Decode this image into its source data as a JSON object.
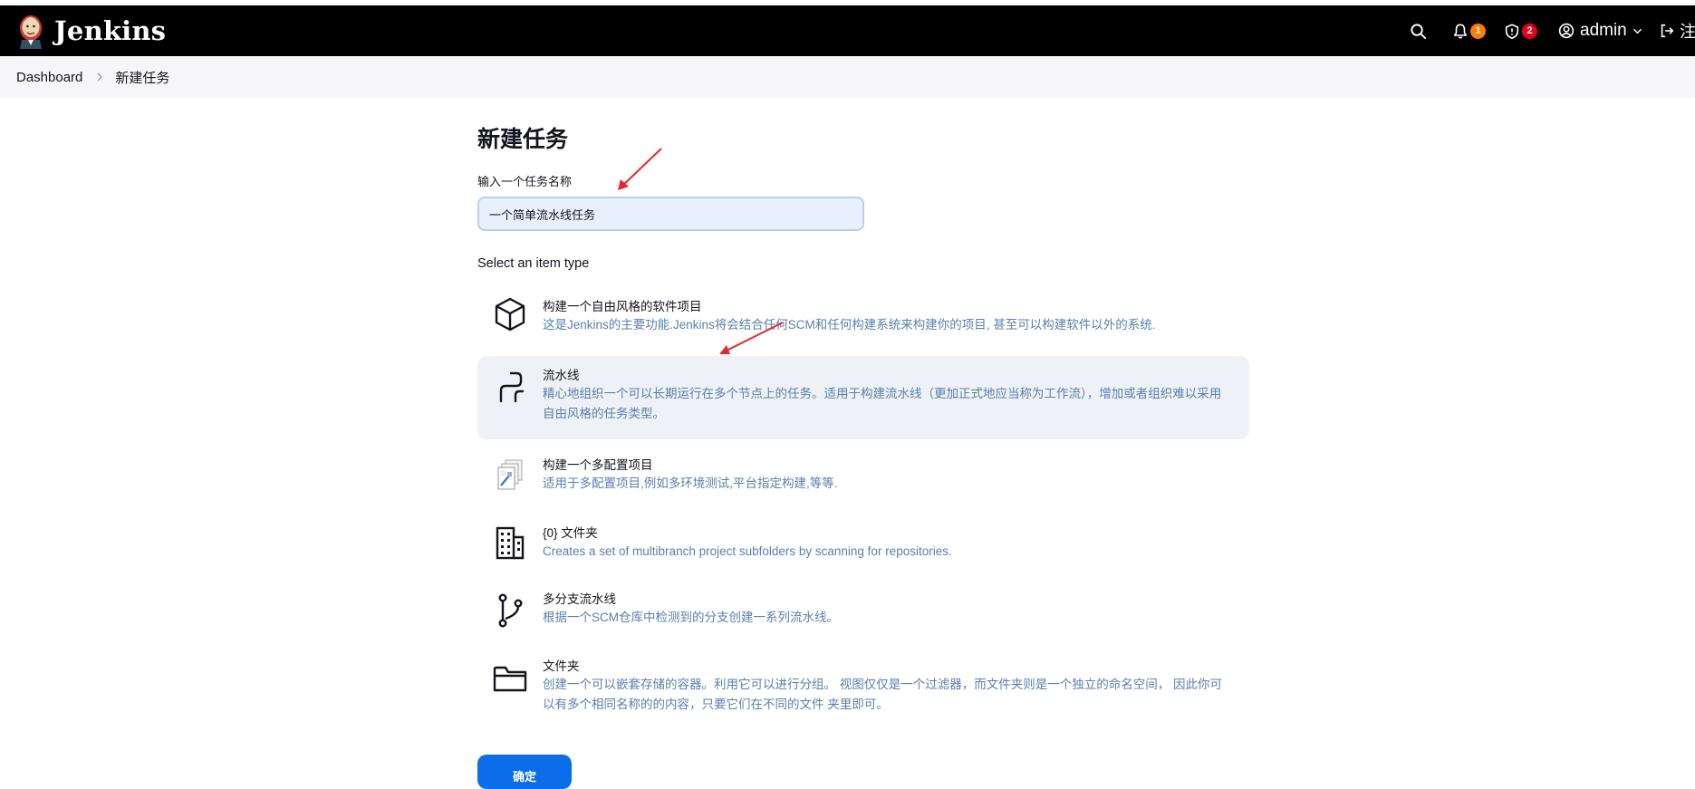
{
  "app": {
    "brand": "Jenkins"
  },
  "navbar": {
    "notifications_count": "1",
    "security_count": "2",
    "user": "admin",
    "logout_label": "注"
  },
  "breadcrumb": {
    "items": [
      "Dashboard",
      "新建任务"
    ]
  },
  "page": {
    "title": "新建任务",
    "name_label": "输入一个任务名称",
    "name_value": "一个简单流水线任务",
    "type_label": "Select an item type",
    "submit_label": "确定"
  },
  "item_types": [
    {
      "name": "构建一个自由风格的软件项目",
      "description": "这是Jenkins的主要功能.Jenkins将会结合任何SCM和任何构建系统来构建你的项目, 甚至可以构建软件以外的系统.",
      "icon": "freestyle-cube-icon",
      "selected": false
    },
    {
      "name": "流水线",
      "description": "精心地组织一个可以长期运行在多个节点上的任务。适用于构建流水线（更加正式地应当称为工作流），增加或者组织难以采用自由风格的任务类型。",
      "icon": "pipeline-icon",
      "selected": true
    },
    {
      "name": "构建一个多配置项目",
      "description": "适用于多配置项目,例如多环境测试,平台指定构建,等等.",
      "icon": "multi-config-icon",
      "selected": false
    },
    {
      "name": "{0} 文件夹",
      "description": "Creates a set of multibranch project subfolders by scanning for repositories.",
      "icon": "organization-folder-icon",
      "selected": false
    },
    {
      "name": "多分支流水线",
      "description": "根据一个SCM仓库中检测到的分支创建一系列流水线。",
      "icon": "branch-icon",
      "selected": false
    },
    {
      "name": "文件夹",
      "description": "创建一个可以嵌套存储的容器。利用它可以进行分组。 视图仅仅是一个过滤器，而文件夹则是一个独立的命名空间， 因此你可以有多个相同名称的的内容，只要它们在不同的文件 夹里即可。",
      "icon": "folder-icon",
      "selected": false
    }
  ],
  "colors": {
    "navbar": "#000000",
    "accent": "#0b6ee8",
    "description": "#5a80ad",
    "selected_bg": "#eef1f6",
    "annotation_arrow": "#e8262b"
  }
}
